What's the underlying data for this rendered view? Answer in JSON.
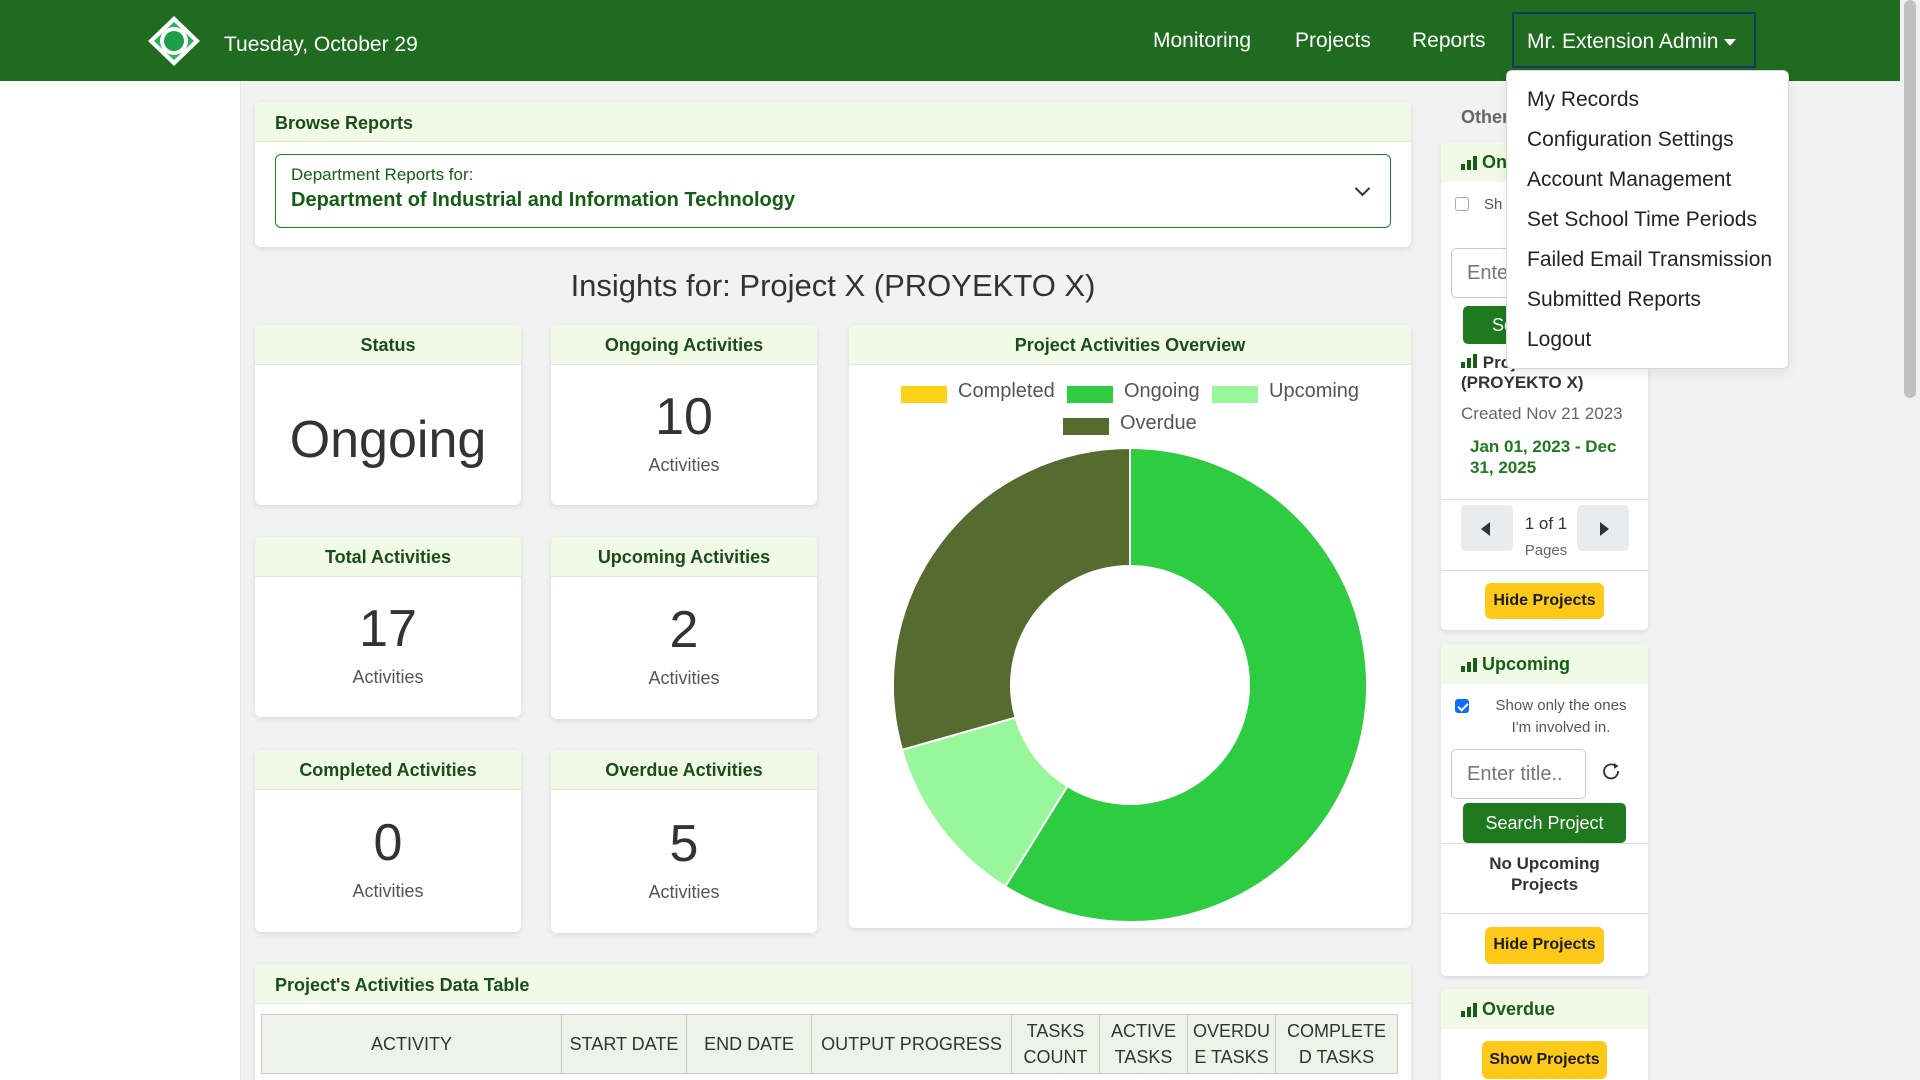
{
  "navbar": {
    "date": "Tuesday, October 29",
    "links": [
      "Monitoring",
      "Projects",
      "Reports"
    ],
    "user": "Mr. Extension Admin",
    "colors": {
      "navbar": "#1f6b1f",
      "accent": "#2ecc40"
    }
  },
  "user_menu": {
    "items": [
      "My Records",
      "Configuration Settings",
      "Account Management",
      "Set School Time Periods",
      "Failed Email Transmission",
      "Submitted Reports",
      "Logout"
    ]
  },
  "browse": {
    "header": "Browse Reports",
    "select_label": "Department Reports for:",
    "select_value": "Department of Industrial and Information Technology"
  },
  "insights": {
    "title": "Insights for: Project X (PROYEKTO X)"
  },
  "stats": {
    "status": {
      "label": "Status",
      "value": "Ongoing"
    },
    "ongoing": {
      "label": "Ongoing Activities",
      "value": "10",
      "unit": "Activities"
    },
    "total": {
      "label": "Total Activities",
      "value": "17",
      "unit": "Activities"
    },
    "upcoming": {
      "label": "Upcoming Activities",
      "value": "2",
      "unit": "Activities"
    },
    "completed": {
      "label": "Completed Activities",
      "value": "0",
      "unit": "Activities"
    },
    "overdue": {
      "label": "Overdue Activities",
      "value": "5",
      "unit": "Activities"
    }
  },
  "chart_data": {
    "type": "pie",
    "title": "Project Activities Overview",
    "donut": true,
    "legend_position": "top",
    "categories": [
      "Completed",
      "Ongoing",
      "Upcoming",
      "Overdue"
    ],
    "values": [
      0,
      10,
      2,
      5
    ],
    "colors": [
      "#ffd21a",
      "#2ecc40",
      "#98f79a",
      "#556b2f"
    ]
  },
  "data_table": {
    "header": "Project's Activities Data Table",
    "columns": [
      [
        "ACTIVITY"
      ],
      [
        "START DATE"
      ],
      [
        "END DATE"
      ],
      [
        "OUTPUT PROGRESS"
      ],
      [
        "TASKS",
        "COUNT"
      ],
      [
        "ACTIVE",
        "TASKS"
      ],
      [
        "OVERDU",
        "E TASKS"
      ],
      [
        "COMPLETE",
        "D TASKS"
      ]
    ]
  },
  "sidebar": {
    "other_label": "Other",
    "ongoing_card": {
      "header_partial": "On",
      "show_partial": "Sh",
      "input_partial": "Ente",
      "button_partial": "Se",
      "project_title_partial": "Project",
      "project_title_line2": "(PROYEKTO X)",
      "created": "Created Nov 21 2023",
      "date_range_line1": "Jan 01, 2023 - Dec",
      "date_range_line2": "31, 2025",
      "pager_text": "1 of 1",
      "pager_unit": "Pages",
      "hide_button": "Hide Projects"
    },
    "upcoming_card": {
      "header": "Upcoming",
      "checkbox_line1": "Show only the ones",
      "checkbox_line2": "I'm involved in.",
      "checkbox_checked": true,
      "search_placeholder": "Enter title..",
      "search_button": "Search Project",
      "empty_line1": "No Upcoming",
      "empty_line2": "Projects",
      "hide_button": "Hide Projects"
    },
    "overdue_card": {
      "header": "Overdue",
      "show_button": "Show Projects"
    }
  }
}
